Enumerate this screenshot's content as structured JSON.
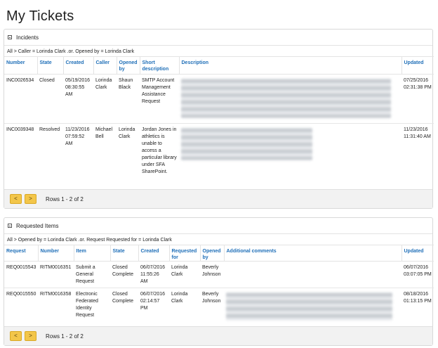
{
  "page": {
    "title": "My Tickets"
  },
  "incidents": {
    "header": "Incidents",
    "filter": "All > Caller = Lorinda Clark .or. Opened by = Lorinda Clark",
    "columns": [
      "Number",
      "State",
      "Created",
      "Caller",
      "Opened by",
      "Short description",
      "Description",
      "Updated"
    ],
    "rows": [
      {
        "number": "INC0026534",
        "state": "Closed",
        "created": "05/19/2016 08:30:55 AM",
        "caller": "Lorinda Clark",
        "opened_by": "Shaun Black",
        "short_description": "SMTP Account Management Assistance Request",
        "updated": "07/25/2016 02:31:38 PM"
      },
      {
        "number": "INC0039348",
        "state": "Resolved",
        "created": "11/23/2016 07:59:52 AM",
        "caller": "Michael Bell",
        "opened_by": "Lorinda Clark",
        "short_description": "Jordan Jones in athletics is unable to access a particular library under SFA SharePoint.",
        "updated": "11/23/2016 11:31:40 AM"
      }
    ],
    "pager": {
      "prev": "<",
      "next": ">",
      "info": "Rows 1 - 2 of 2"
    }
  },
  "requested_items": {
    "header": "Requested Items",
    "filter": "All > Opened by = Lorinda Clark .or. Request Requested for = Lorinda Clark",
    "columns": [
      "Request",
      "Number",
      "Item",
      "State",
      "Created",
      "Requested for",
      "Opened by",
      "Additional comments",
      "Updated"
    ],
    "rows": [
      {
        "request": "REQ0015543",
        "number": "RITM0016351",
        "item": "Submit a General Request",
        "state": "Closed Complete",
        "created": "06/07/2016 11:55:26 AM",
        "requested_for": "Lorinda Clark",
        "opened_by": "Beverly Johnson",
        "updated": "06/07/2016 03:07:05 PM"
      },
      {
        "request": "REQ0015550",
        "number": "RITM0016358",
        "item": "Electronic Federated Identity Request",
        "state": "Closed Complete",
        "created": "06/07/2016 02:14:57 PM",
        "requested_for": "Lorinda Clark",
        "opened_by": "Beverly Johnson",
        "updated": "08/18/2016 01:13:15 PM"
      }
    ],
    "pager": {
      "prev": "<",
      "next": ">",
      "info": "Rows 1 - 2 of 2"
    }
  },
  "colors": {
    "link": "#1f6fb8",
    "pager_button": "#f3c64a",
    "pager_bg": "#f2f2f2"
  }
}
